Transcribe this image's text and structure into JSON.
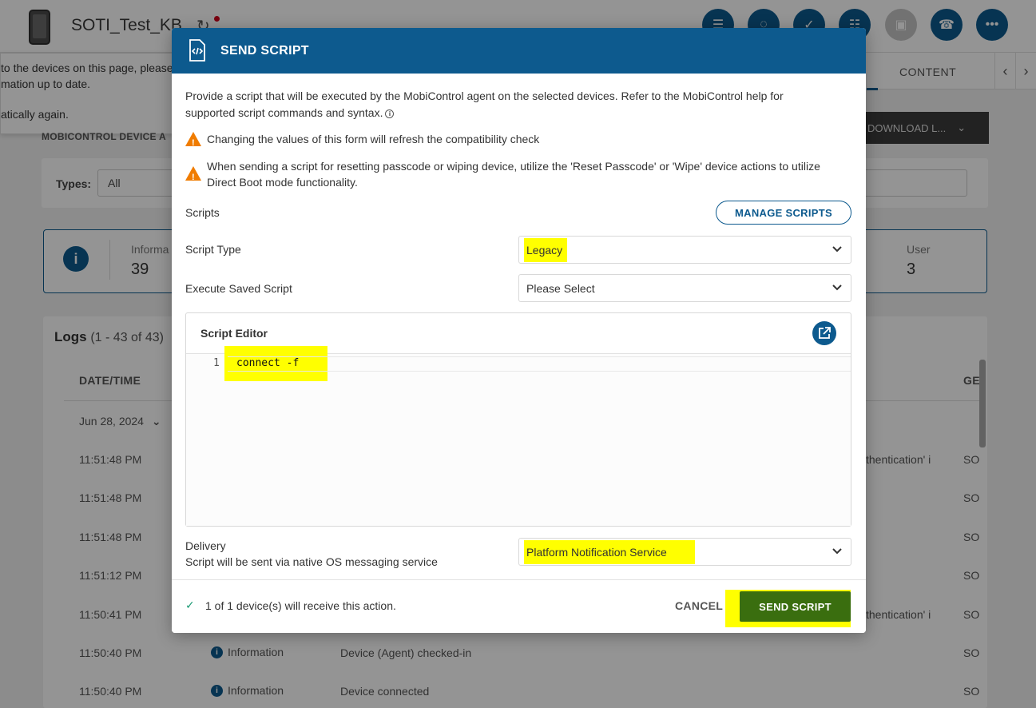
{
  "background": {
    "device_name": "SOTI_Test_KB",
    "tabs": {
      "content": "CONTENT"
    },
    "toast": {
      "line1": "to the devices on this page, please",
      "line2": "mation up to date.",
      "line3": "atically again."
    },
    "section_label": "MOBICONTROL DEVICE A",
    "download_label": "DOWNLOAD L...",
    "types_label": "Types:",
    "types_value": "All",
    "stats": [
      {
        "label": "Informa",
        "value": "39"
      },
      {
        "label": "User",
        "value": "3"
      }
    ],
    "logs": {
      "title": "Logs",
      "count": "(1 - 43 of 43)",
      "columns": {
        "datetime": "DATE/TIME",
        "gen": "GEI"
      },
      "date_group": "Jun 28, 2024",
      "rows": [
        {
          "time": "11:51:48 PM",
          "severity": "",
          "message": "",
          "ext": "thentication' i",
          "gen": "SO"
        },
        {
          "time": "11:51:48 PM",
          "severity": "",
          "message": "",
          "ext": "",
          "gen": "SO"
        },
        {
          "time": "11:51:48 PM",
          "severity": "",
          "message": "",
          "ext": "",
          "gen": "SO"
        },
        {
          "time": "11:51:12 PM",
          "severity": "",
          "message": "",
          "ext": "",
          "gen": "SO"
        },
        {
          "time": "11:50:41 PM",
          "severity": "",
          "message": "",
          "ext": "thentication' i",
          "gen": "SO"
        },
        {
          "time": "11:50:40 PM",
          "severity": "Information",
          "message": "Device (Agent) checked-in",
          "ext": "",
          "gen": "SO"
        },
        {
          "time": "11:50:40 PM",
          "severity": "Information",
          "message": "Device connected",
          "ext": "",
          "gen": "SO"
        }
      ]
    }
  },
  "modal": {
    "title": "SEND SCRIPT",
    "description": "Provide a script that will be executed by the MobiControl agent on the selected devices. Refer to the MobiControl help for supported script commands and syntax.",
    "warnings": [
      "Changing the values of this form will refresh the compatibility check",
      "When sending a script for resetting passcode or wiping device, utilize the 'Reset Passcode' or 'Wipe' device actions to utilize Direct Boot mode functionality."
    ],
    "scripts_label": "Scripts",
    "manage_scripts_label": "MANAGE SCRIPTS",
    "script_type": {
      "label": "Script Type",
      "value": "Legacy"
    },
    "saved_script": {
      "label": "Execute Saved Script",
      "value": "Please Select"
    },
    "editor": {
      "title": "Script Editor",
      "line_number": "1",
      "code": "connect -f"
    },
    "delivery": {
      "label": "Delivery",
      "sublabel": "Script will be sent via native OS messaging service",
      "value": "Platform Notification Service"
    },
    "footer": {
      "status": "1 of 1 device(s) will receive this action.",
      "cancel_label": "CANCEL",
      "send_label": "SEND SCRIPT"
    }
  },
  "colors": {
    "brand": "#0d5a8e",
    "warning": "#f07c00",
    "send_button": "#3a6e0f",
    "highlight": "#ffff00",
    "check": "#1a9a73"
  }
}
